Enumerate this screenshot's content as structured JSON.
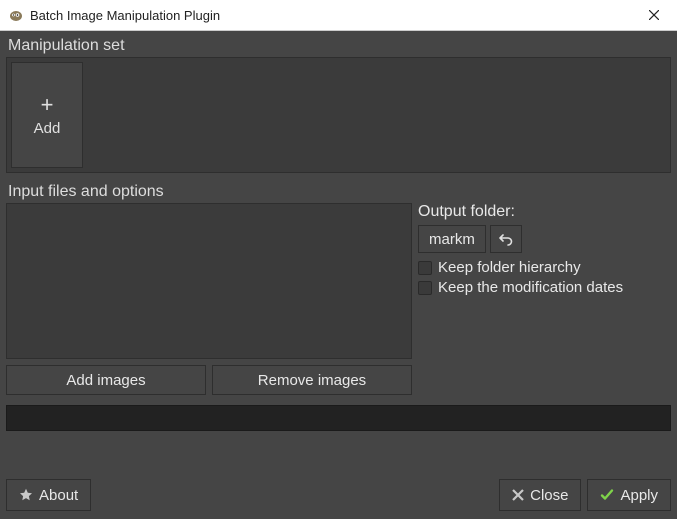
{
  "window": {
    "title": "Batch Image Manipulation Plugin"
  },
  "manipulation": {
    "section_label": "Manipulation set",
    "add_label": "Add"
  },
  "input": {
    "section_label": "Input files and options",
    "add_images_label": "Add images",
    "remove_images_label": "Remove images"
  },
  "output": {
    "label": "Output folder:",
    "folder_value": "markm",
    "keep_hierarchy_label": "Keep folder hierarchy",
    "keep_hierarchy_checked": false,
    "keep_dates_label": "Keep the modification dates",
    "keep_dates_checked": false
  },
  "footer": {
    "about_label": "About",
    "close_label": "Close",
    "apply_label": "Apply"
  },
  "icons": {
    "app": "gimp-icon",
    "plus": "plus-icon",
    "reset": "undo-icon",
    "star": "star-icon",
    "close_x": "close-x-icon",
    "check": "check-icon"
  }
}
